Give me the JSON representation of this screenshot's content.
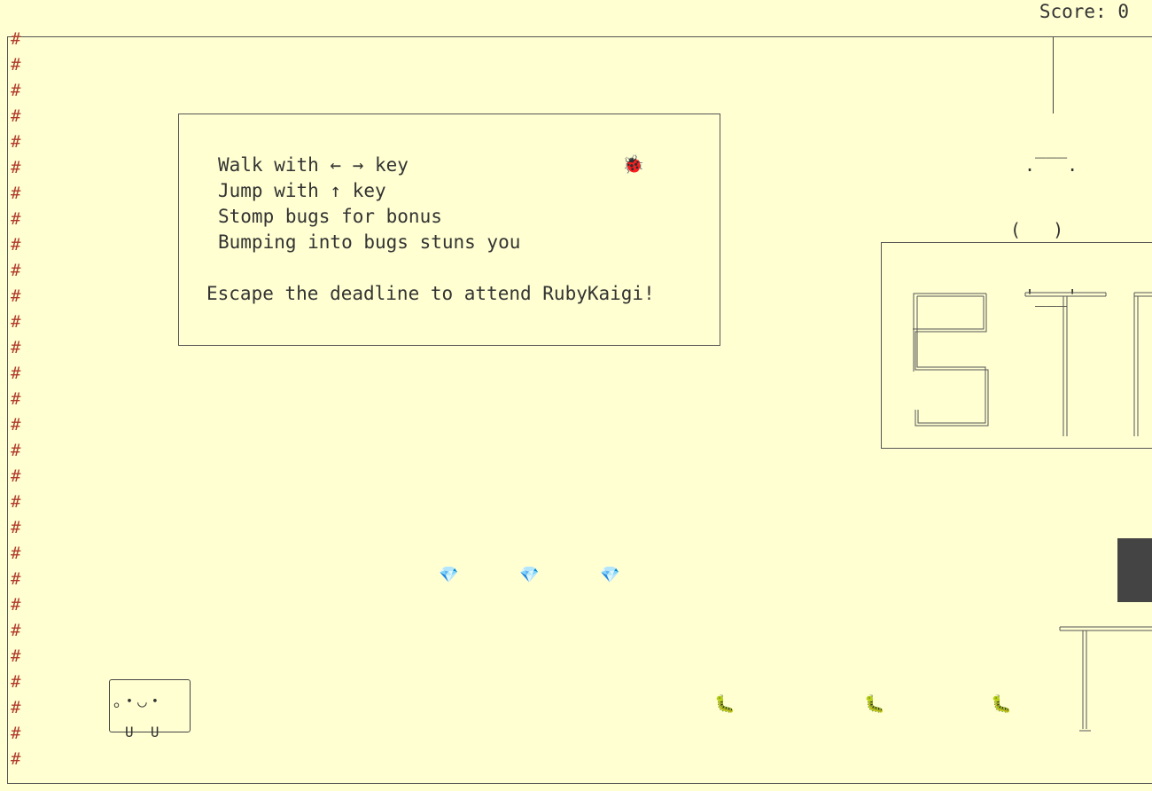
{
  "hud": {
    "score_text": "Score: 0"
  },
  "instructions": {
    "lines": [
      "Walk with ← → key",
      "Jump with ↑ key",
      "Stomp bugs for bonus",
      "Bumping into bugs stuns you"
    ],
    "goal": "Escape the deadline to attend RubyKaigi!"
  },
  "wall_char": "#",
  "lamp": {
    "top": ".‾‾‾.",
    "middle": "(   )",
    "bottom": "'___'"
  },
  "sprites": {
    "ladybug": "🐞",
    "gem": "💎",
    "bug": "🐛"
  },
  "player": {
    "face": "。・◡・",
    "feet": "U  U"
  },
  "colors": {
    "background": "#ffffd2",
    "wall": "#b13a2a",
    "ink": "#333333"
  }
}
